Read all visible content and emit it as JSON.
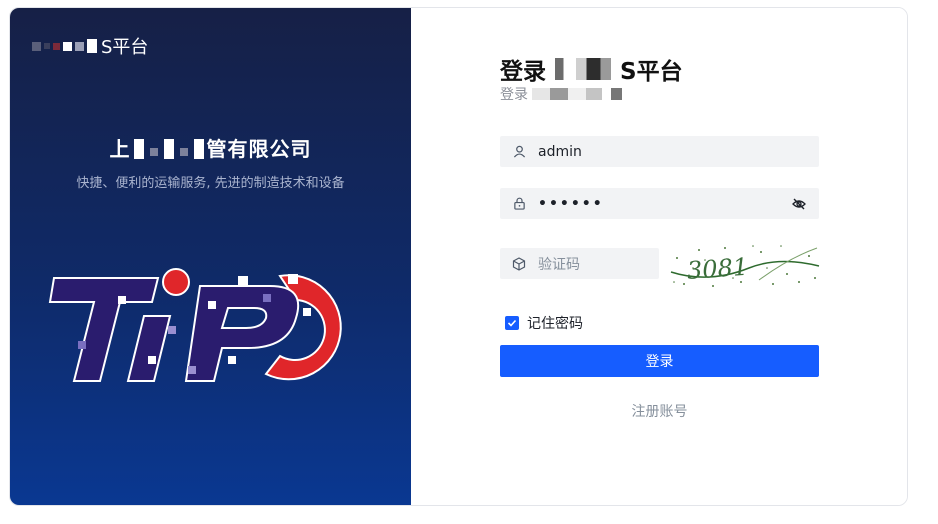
{
  "brand": {
    "name_visible": "S平台",
    "logo_icon": "pixelated-logo-icon"
  },
  "left_panel": {
    "company_prefix": "上",
    "company_suffix": "管有限公司",
    "slogan": "快捷、便利的运输服务, 先进的制造技术和设备",
    "big_logo_icon": "tiPO-logo"
  },
  "login": {
    "title_prefix": "登录",
    "title_suffix": "S平台",
    "subtitle_prefix": "登录",
    "username": {
      "value": "admin",
      "icon": "user-icon"
    },
    "password": {
      "value": "••••••",
      "icon": "lock-icon",
      "toggle_icon": "eye-off-icon"
    },
    "captcha": {
      "placeholder": "验证码",
      "icon": "cube-icon",
      "code": "3081"
    },
    "remember_label": "记住密码",
    "remember_checked": true,
    "submit_label": "登录",
    "register_label": "注册账号"
  },
  "colors": {
    "primary": "#165dff",
    "panel_top": "#162046",
    "panel_bottom": "#0a3892"
  }
}
